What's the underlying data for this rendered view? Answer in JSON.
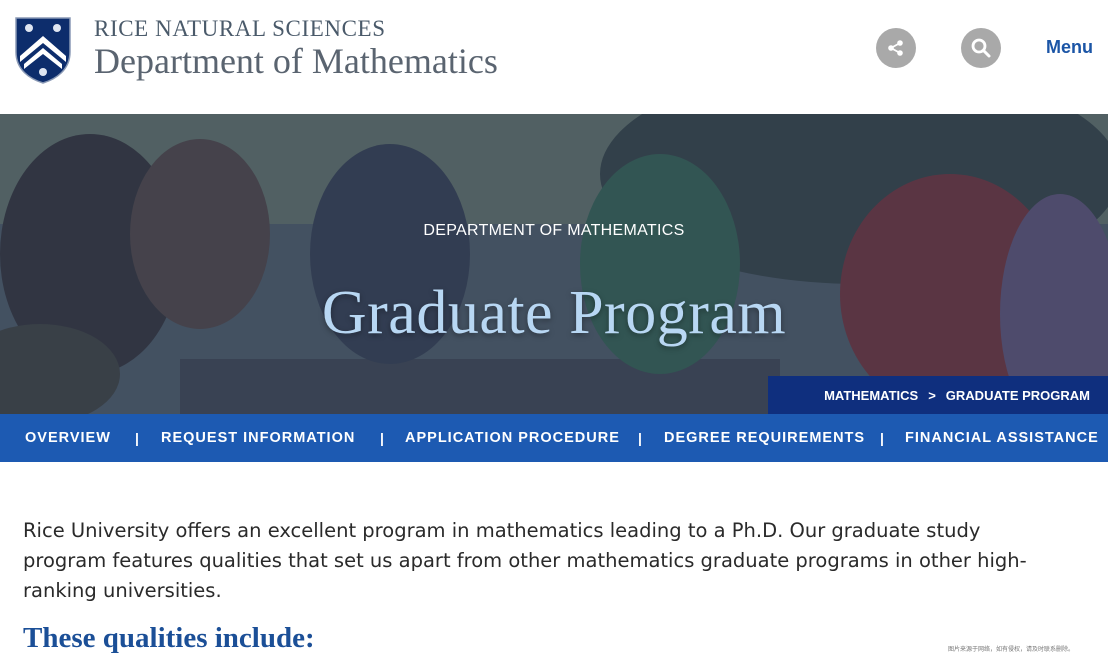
{
  "header": {
    "brand_top": "RICE NATURAL SCIENCES",
    "brand_main": "Department of Mathematics",
    "share_icon": "share-icon",
    "search_icon": "search-icon",
    "menu_label": "Menu"
  },
  "hero": {
    "eyebrow": "DEPARTMENT OF MATHEMATICS",
    "title": "Graduate Program",
    "breadcrumb": {
      "items": [
        "MATHEMATICS",
        "GRADUATE PROGRAM"
      ],
      "separator": ">"
    }
  },
  "subnav": {
    "items": [
      {
        "label": "OVERVIEW"
      },
      {
        "label": "REQUEST INFORMATION"
      },
      {
        "label": "APPLICATION PROCEDURE"
      },
      {
        "label": "DEGREE REQUIREMENTS"
      },
      {
        "label": "FINANCIAL ASSISTANCE"
      }
    ],
    "separator": "|"
  },
  "content": {
    "intro": "Rice University offers an excellent program in mathematics leading to a Ph.D. Our graduate study program features qualities that set us apart from other mathematics graduate programs in other high-ranking universities.",
    "qualities_heading": "These qualities include:"
  },
  "footnote": "图片来源于网络，如有侵权，请及时联系删除。",
  "colors": {
    "brand_blue": "#1b55a6",
    "nav_blue": "#1d5ab2",
    "breadcrumb_navy": "#0f2f7e",
    "hero_title": "#b8d7f3",
    "heading_blue": "#1b4f97",
    "icon_gray": "#a9a9a9"
  }
}
